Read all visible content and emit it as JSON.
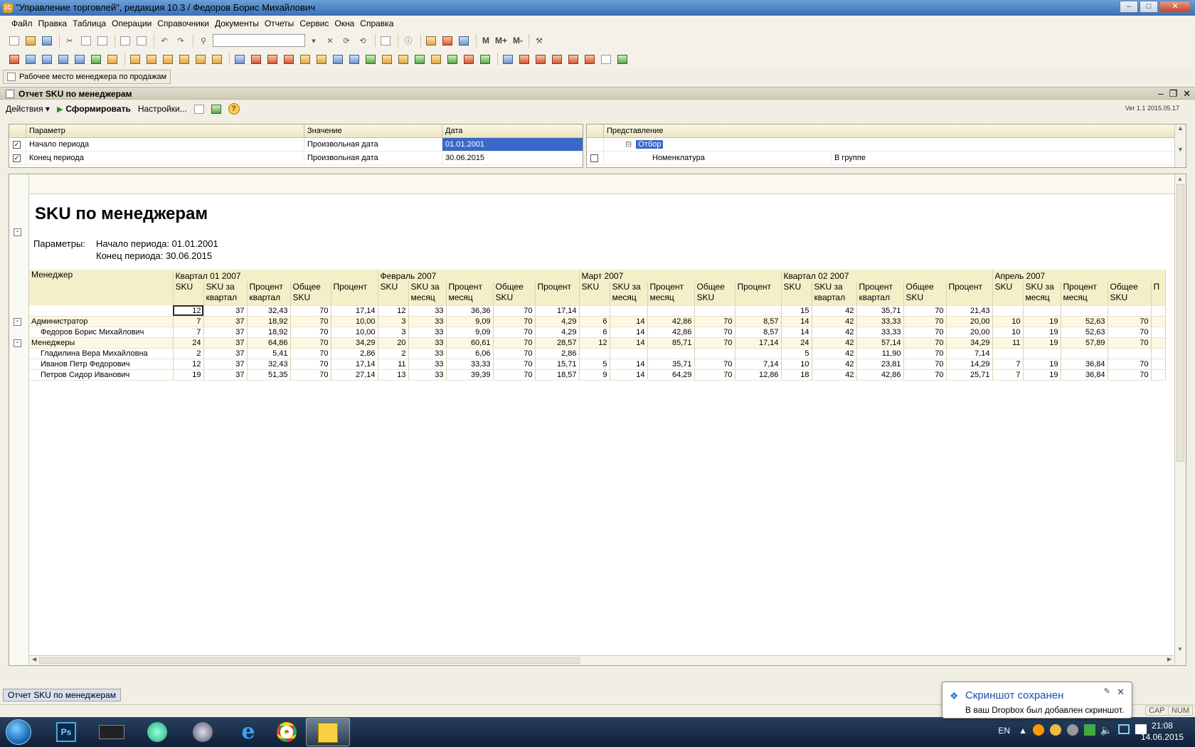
{
  "window": {
    "title": "\"Управление торговлей\", редакция 10.3 / Федоров Борис Михайлович",
    "app_icon": "1C"
  },
  "menu": [
    "Файл",
    "Правка",
    "Таблица",
    "Операции",
    "Справочники",
    "Документы",
    "Отчеты",
    "Сервис",
    "Окна",
    "Справка"
  ],
  "toolbar": {
    "m_label": "M",
    "mplus_label": "M+",
    "mminus_label": "M-"
  },
  "workplace_button": "Рабочее место менеджера по продажам",
  "report_window": {
    "title": "Отчет  SKU по менеджерам"
  },
  "actions": {
    "actions_label": "Действия",
    "run_label": "Сформировать",
    "settings_label": "Настройки...",
    "help_label": "?",
    "version": "Ver 1.1  2015.05.17"
  },
  "params": {
    "headers": [
      "Параметр",
      "Значение",
      "Дата"
    ],
    "rows": [
      {
        "checked": true,
        "name": "Начало периода",
        "value": "Произвольная дата",
        "date": "01.01.2001"
      },
      {
        "checked": true,
        "name": "Конец периода",
        "value": "Произвольная дата",
        "date": "30.06.2015"
      }
    ]
  },
  "filter": {
    "header": "Представление",
    "root": "Отбор",
    "item": "Номенклатура",
    "condition": "В группе"
  },
  "report": {
    "title": "SKU по менеджерам",
    "params_label": "Параметры:",
    "start_label": "Начало периода: 01.01.2001",
    "end_label": "Конец периода: 30.06.2015",
    "manager_header": "Менеджер",
    "groups": [
      {
        "label": "Квартал 01 2007",
        "span": 5
      },
      {
        "label": "Февраль 2007",
        "span": 5
      },
      {
        "label": "Март 2007",
        "span": 5
      },
      {
        "label": "Квартал 02 2007",
        "span": 5
      },
      {
        "label": "Апрель 2007",
        "span": 5
      }
    ],
    "subheaders": [
      "SKU",
      "SKU за квартал",
      "Процент квартал",
      "Общее SKU",
      "Процент",
      "SKU",
      "SKU за месяц",
      "Процент месяц",
      "Общее SKU",
      "Процент",
      "SKU",
      "SKU за месяц",
      "Процент месяц",
      "Общее SKU",
      "Процент",
      "SKU",
      "SKU за квартал",
      "Процент квартал",
      "Общее SKU",
      "Процент",
      "SKU",
      "SKU за месяц",
      "Процент месяц",
      "Общее SKU",
      "П"
    ],
    "rows": [
      {
        "type": "tot",
        "name": "",
        "cells": [
          "12",
          "37",
          "32,43",
          "70",
          "17,14",
          "12",
          "33",
          "36,36",
          "70",
          "17,14",
          "",
          "",
          "",
          "",
          "",
          "15",
          "42",
          "35,71",
          "70",
          "21,43",
          "",
          "",
          "",
          "",
          ""
        ]
      },
      {
        "type": "grp",
        "name": "Администратор",
        "cells": [
          "7",
          "37",
          "18,92",
          "70",
          "10,00",
          "3",
          "33",
          "9,09",
          "70",
          "4,29",
          "6",
          "14",
          "42,86",
          "70",
          "8,57",
          "14",
          "42",
          "33,33",
          "70",
          "20,00",
          "10",
          "19",
          "52,63",
          "70",
          ""
        ]
      },
      {
        "type": "sub",
        "name": "Федоров Борис Михайлович",
        "cells": [
          "7",
          "37",
          "18,92",
          "70",
          "10,00",
          "3",
          "33",
          "9,09",
          "70",
          "4,29",
          "6",
          "14",
          "42,86",
          "70",
          "8,57",
          "14",
          "42",
          "33,33",
          "70",
          "20,00",
          "10",
          "19",
          "52,63",
          "70",
          ""
        ]
      },
      {
        "type": "grp",
        "name": "Менеджеры",
        "cells": [
          "24",
          "37",
          "64,86",
          "70",
          "34,29",
          "20",
          "33",
          "60,61",
          "70",
          "28,57",
          "12",
          "14",
          "85,71",
          "70",
          "17,14",
          "24",
          "42",
          "57,14",
          "70",
          "34,29",
          "11",
          "19",
          "57,89",
          "70",
          ""
        ]
      },
      {
        "type": "sub",
        "name": "Гладилина Вера Михайловна",
        "cells": [
          "2",
          "37",
          "5,41",
          "70",
          "2,86",
          "2",
          "33",
          "6,06",
          "70",
          "2,86",
          "",
          "",
          "",
          "",
          "",
          "5",
          "42",
          "11,90",
          "70",
          "7,14",
          "",
          "",
          "",
          "",
          ""
        ]
      },
      {
        "type": "sub",
        "name": "Иванов Петр Федорович",
        "cells": [
          "12",
          "37",
          "32,43",
          "70",
          "17,14",
          "11",
          "33",
          "33,33",
          "70",
          "15,71",
          "5",
          "14",
          "35,71",
          "70",
          "7,14",
          "10",
          "42",
          "23,81",
          "70",
          "14,29",
          "7",
          "19",
          "36,84",
          "70",
          ""
        ]
      },
      {
        "type": "sub",
        "name": "Петров Сидор Иванович",
        "cells": [
          "19",
          "37",
          "51,35",
          "70",
          "27,14",
          "13",
          "33",
          "39,39",
          "70",
          "18,57",
          "9",
          "14",
          "64,29",
          "70",
          "12,86",
          "18",
          "42",
          "42,86",
          "70",
          "25,71",
          "7",
          "19",
          "36,84",
          "70",
          ""
        ]
      }
    ]
  },
  "bottom_tab": "Отчет  SKU по менеджерам",
  "notification": {
    "title": "Скриншот сохранен",
    "text": "В ваш Dropbox был добавлен скриншот."
  },
  "status_indicators": [
    "CAP",
    "NUM"
  ],
  "tray": {
    "lang": "EN",
    "time": "21:08",
    "date": "14.06.2015"
  }
}
